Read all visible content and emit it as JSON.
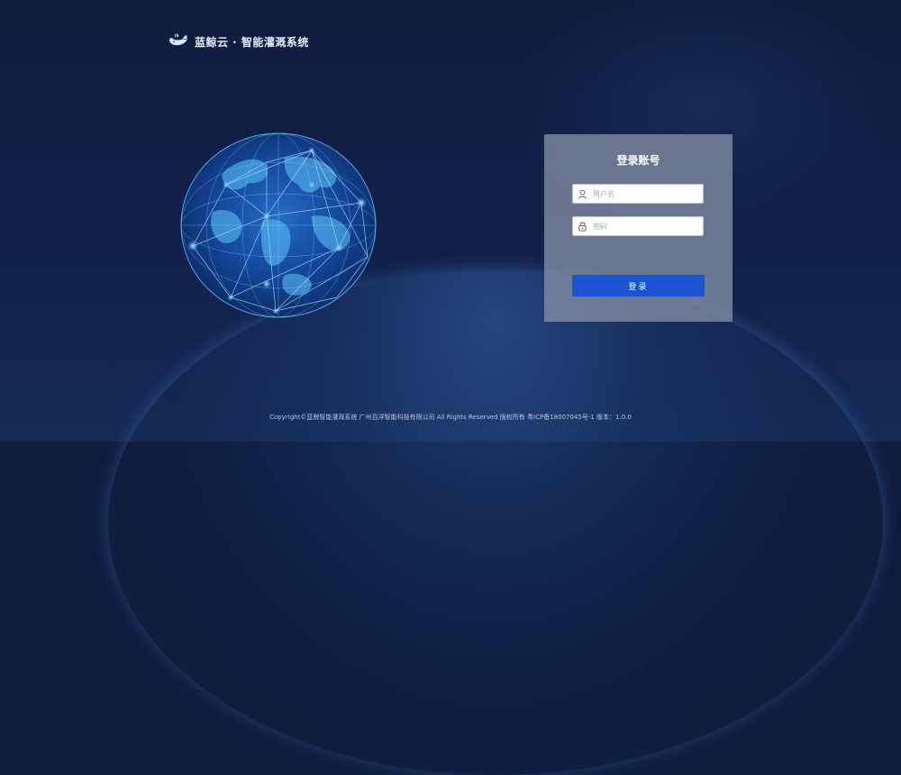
{
  "header": {
    "logo_icon": "whale-icon",
    "brand_name": "蓝鲸云 · 智能灌溉系统"
  },
  "login": {
    "title": "登录账号",
    "username": {
      "placeholder": "用户名",
      "value": "",
      "icon": "user-icon"
    },
    "password": {
      "placeholder": "密码",
      "value": "",
      "icon": "lock-icon"
    },
    "submit_label": "登录"
  },
  "footer": {
    "text": "Copyright©蓝鲸智能灌溉系统 广州百洋智能科技有限公司 All Rights Reserved 版权所有 粤ICP备18007045号-1 版本：1.0.0"
  },
  "colors": {
    "background": "#0f1d3f",
    "card": "#8c96aa",
    "button": "#1b54d1",
    "globe_glow": "#3fa9ff"
  }
}
